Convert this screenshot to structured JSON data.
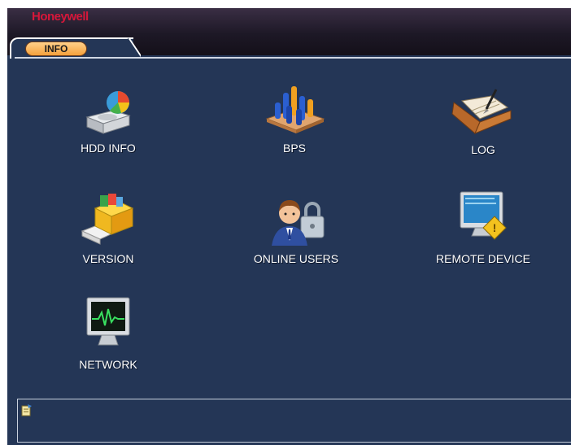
{
  "window": {
    "brand": "Honeywell",
    "tab": "INFO"
  },
  "menu": {
    "items": [
      {
        "label": "HDD INFO",
        "icon": "hdd-icon"
      },
      {
        "label": "BPS",
        "icon": "bps-chart-icon"
      },
      {
        "label": "LOG",
        "icon": "log-book-icon"
      },
      {
        "label": "VERSION",
        "icon": "version-box-icon"
      },
      {
        "label": "ONLINE USERS",
        "icon": "online-users-icon"
      },
      {
        "label": "REMOTE DEVICE",
        "icon": "remote-device-icon"
      },
      {
        "label": "NETWORK",
        "icon": "network-monitor-icon"
      }
    ]
  },
  "status": {
    "icon": "status-note-icon",
    "text": ""
  },
  "colors": {
    "background": "#243656",
    "titlebar": "#1d1826",
    "brand": "#d6173a",
    "tab_pill": "#f5a13c"
  }
}
